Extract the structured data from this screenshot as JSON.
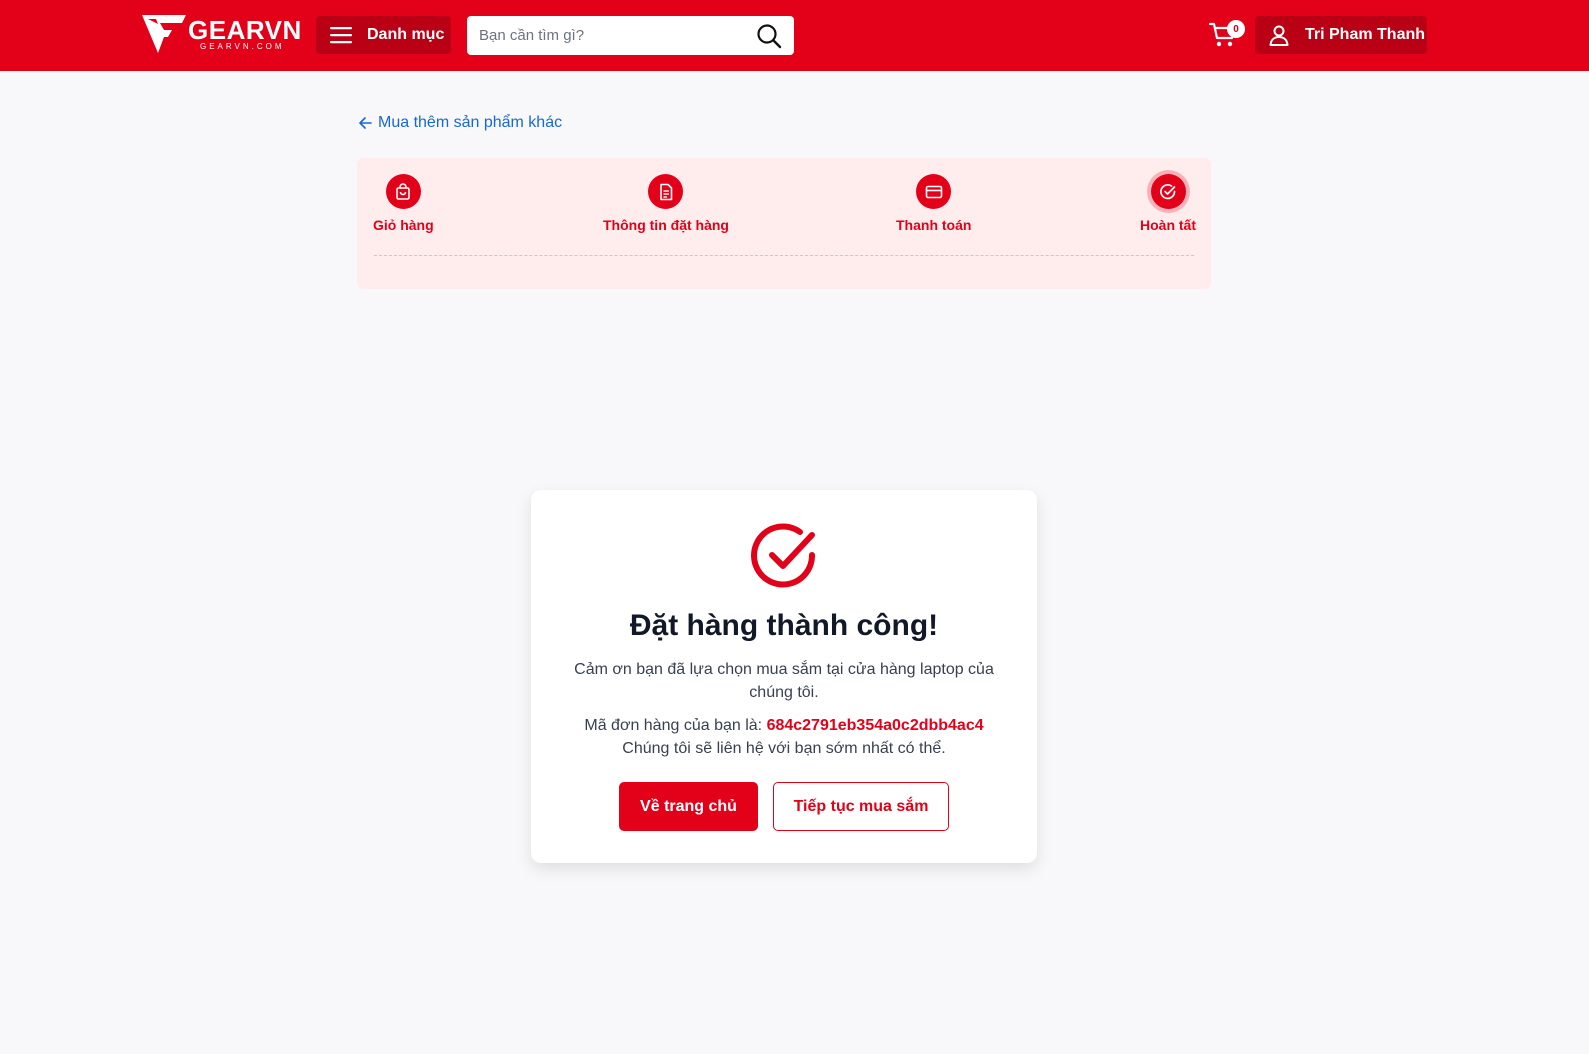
{
  "header": {
    "logo_text": "GEARVN",
    "logo_sub": "GEARVN.COM",
    "menu_label": "Danh mục",
    "search_placeholder": "Bạn cần tìm gì?",
    "cart_count": "0",
    "user_name": "Tri Pham Thanh"
  },
  "back_link": "Mua thêm sản phẩm khác",
  "steps": [
    {
      "label": "Giỏ hàng",
      "icon": "bag-icon"
    },
    {
      "label": "Thông tin đặt hàng",
      "icon": "document-icon"
    },
    {
      "label": "Thanh toán",
      "icon": "credit-card-icon"
    },
    {
      "label": "Hoàn tất",
      "icon": "check-circle-icon",
      "active": true
    }
  ],
  "success": {
    "title": "Đặt hàng thành công!",
    "thanks": "Cảm ơn bạn đã lựa chọn mua sắm tại cửa hàng laptop của chúng tôi.",
    "order_prefix": "Mã đơn hàng của bạn là:",
    "order_code": "684c2791eb354a0c2dbb4ac4",
    "contact": "Chúng tôi sẽ liên hệ với bạn sớm nhất có thể.",
    "home_button": "Về trang chủ",
    "continue_button": "Tiếp tục mua sắm"
  },
  "colors": {
    "brand": "#e30019",
    "link": "#1868d3",
    "steps_bg": "#ffeded",
    "page_bg": "#f8f8fa"
  }
}
